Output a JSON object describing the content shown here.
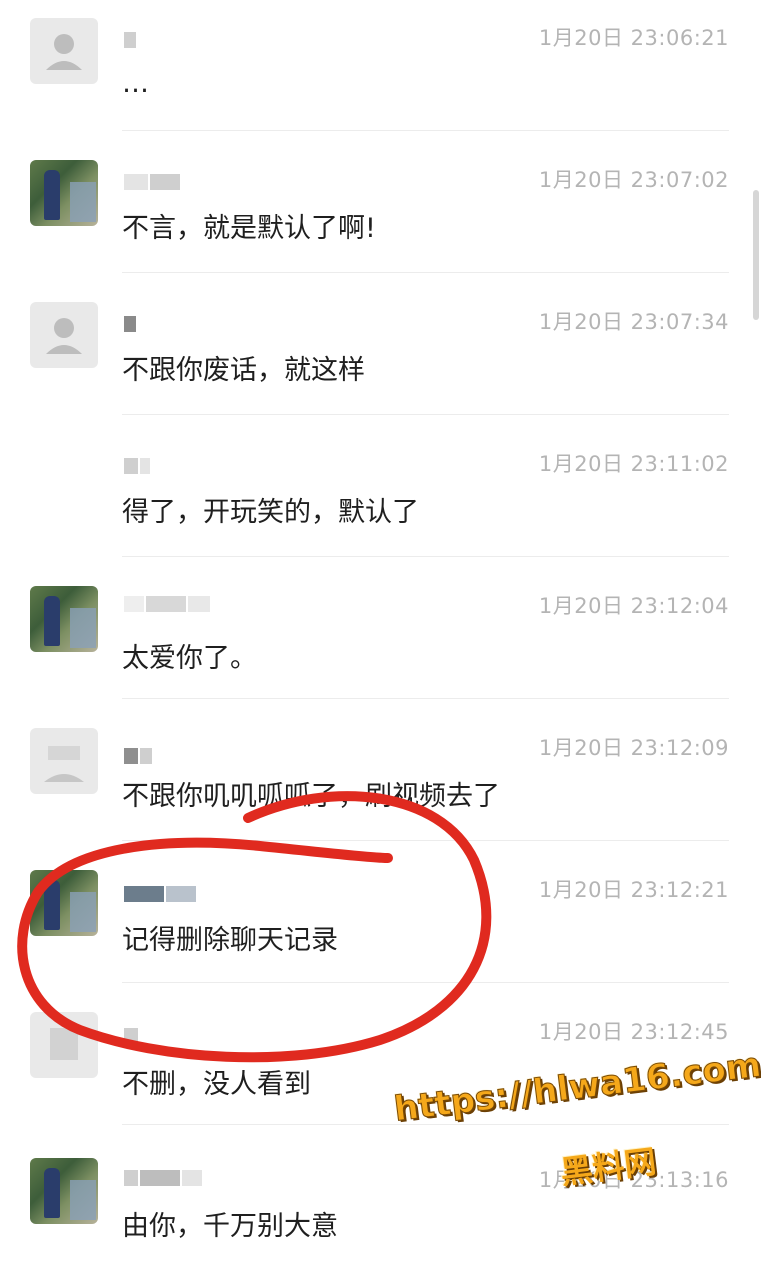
{
  "messages": [
    {
      "avatar": "default-person-icon",
      "time": "1月20日 23:06:21",
      "text": "…"
    },
    {
      "avatar": "photo",
      "time": "1月20日 23:07:02",
      "text": "不言，就是默认了啊!"
    },
    {
      "avatar": "default-person-icon",
      "time": "1月20日 23:07:34",
      "text": "不跟你废话，就这样"
    },
    {
      "avatar": "none",
      "time": "1月20日 23:11:02",
      "text": "得了，开玩笑的，默认了"
    },
    {
      "avatar": "photo",
      "time": "1月20日 23:12:04",
      "text": "太爱你了。"
    },
    {
      "avatar": "default-person-icon",
      "time": "1月20日 23:12:09",
      "text": "不跟你叽叽呱呱了，刷视频去了"
    },
    {
      "avatar": "photo",
      "time": "1月20日 23:12:21",
      "text": "记得删除聊天记录"
    },
    {
      "avatar": "default-person-icon",
      "time": "1月20日 23:12:45",
      "text": "不删，没人看到"
    },
    {
      "avatar": "photo",
      "time": "1月20日 23:13:16",
      "text": "由你，千万别大意"
    }
  ],
  "watermark": {
    "url": "https://hlwa16.com",
    "site": "黑料网"
  },
  "colors": {
    "annotation": "#e02a1f",
    "watermark": "#f5a81a",
    "time": "#b4b4b4"
  }
}
